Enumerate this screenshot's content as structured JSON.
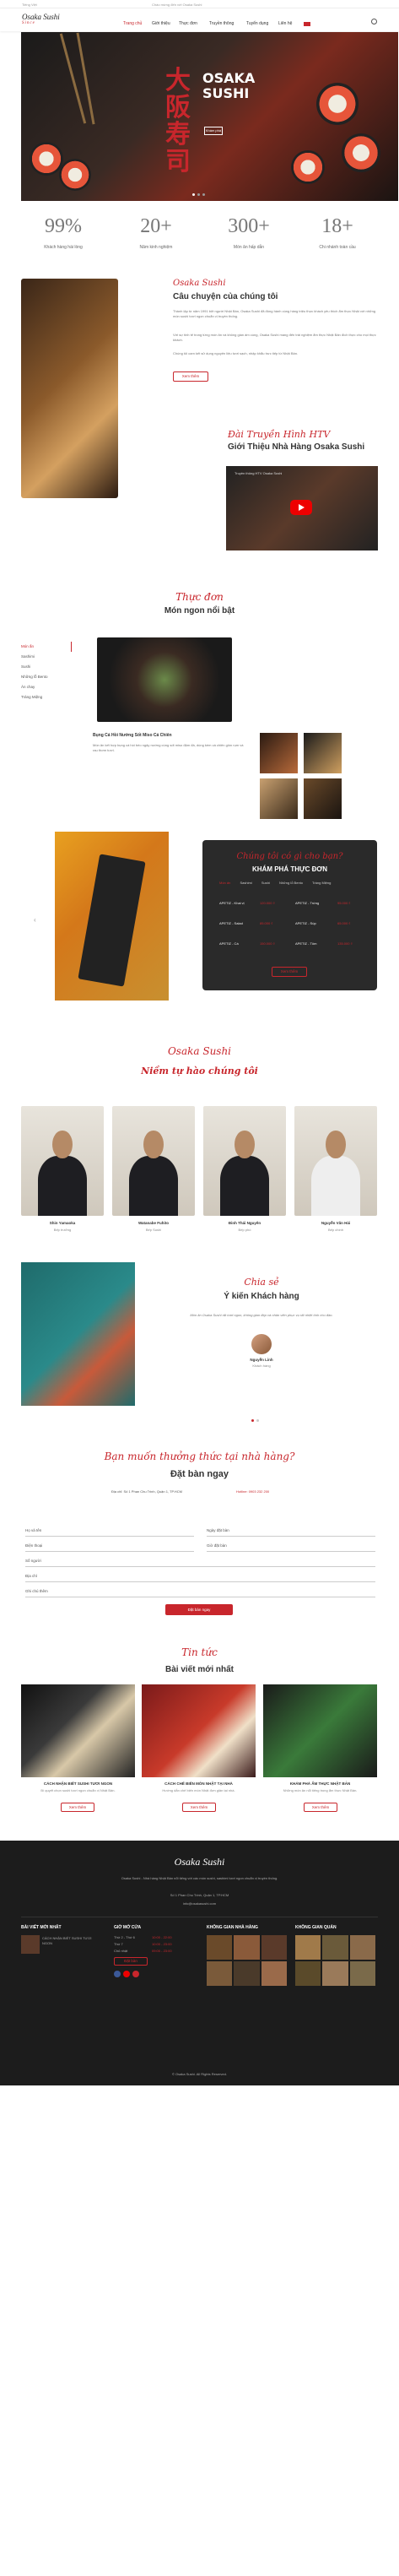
{
  "topbar": {
    "left": "Tiếng Việt",
    "right": "Chào mừng đến với Osaka Sushi"
  },
  "brand": {
    "name": "Osaka Sushi",
    "sub": "Since"
  },
  "nav": [
    "Trang chủ",
    "Giới thiệu",
    "Thực đơn",
    "Truyền thông",
    "Tuyển dụng",
    "Liên hệ"
  ],
  "hero": {
    "title_jp": "大阪寿司",
    "title": "OSAKA SUSHI",
    "button": "Khám phá"
  },
  "stats": [
    {
      "num": "99%",
      "label": "Khách hàng hài lòng"
    },
    {
      "num": "20+",
      "label": "Năm kinh nghiệm"
    },
    {
      "num": "300+",
      "label": "Món ăn hấp dẫn"
    },
    {
      "num": "18+",
      "label": "Chi nhánh toàn cầu"
    }
  ],
  "story": {
    "script": "Osaka Sushi",
    "title": "Câu chuyện của chúng tôi",
    "p1": "Thành lập từ năm 1991 bởi người Nhật Bản, Osaka Sushi đã đồng hành cùng hàng triệu thực khách yêu thích ẩm thực Nhật với những món sushi tươi ngon chuẩn vị truyền thống.",
    "p2": "Với sự tinh tế trong từng món ăn và không gian ấm cúng, Osaka Sushi mang đến trải nghiệm ẩm thực Nhật Bản đích thực cho mọi thực khách.",
    "p3": "Chúng tôi cam kết sử dụng nguyên liệu tươi sạch, nhập khẩu trực tiếp từ Nhật Bản.",
    "button": "Xem thêm"
  },
  "video": {
    "script": "Đài Truyền Hình HTV",
    "title": "Giới Thiệu Nhà Hàng Osaka Sushi",
    "yt_title": "Truyền thông HTV Osaka Sushi"
  },
  "menu": {
    "script": "Thực đơn",
    "title": "Món ngon nổi bật",
    "cats": [
      "Món ấn",
      "Sashimi",
      "Sushi",
      "Những lỗ Bento",
      "Ăn chay",
      "Tráng Miệng"
    ],
    "dish_title": "Bụng Cá Hồi Nướng Sốt Miso Cá Chiên",
    "dish_desc": "Món ăn kết hợp bụng cá hồi béo ngậy nướng cùng sốt miso đậm đà, dùng kèm cá chiên giòn rụm và rau thơm tươi."
  },
  "promo": {
    "script": "Chúng tôi có gì cho bạn?",
    "title": "KHÁM PHÁ THỰC ĐƠN",
    "tabs": [
      "Món ấn",
      "Sashimi",
      "Sushi",
      "Những lỗ Bento",
      "Tráng Miệng"
    ],
    "items": [
      {
        "name": "APETIZ - Khai vị",
        "price": "120.000 ₫"
      },
      {
        "name": "APETIZ - Trứng",
        "price": "95.000 ₫"
      },
      {
        "name": "APETIZ - Salad",
        "price": "85.000 ₫"
      },
      {
        "name": "APETIZ - Súp",
        "price": "65.000 ₫"
      },
      {
        "name": "APETIZ - Cá",
        "price": "150.000 ₫"
      },
      {
        "name": "APETIZ - Tôm",
        "price": "135.000 ₫"
      }
    ],
    "button": "Xem thêm"
  },
  "team": {
    "script": "Osaka Sushi",
    "title": "Niềm tự hào chúng tôi",
    "chefs": [
      {
        "name": "Shin Yamaoka",
        "role": "Bếp trưởng"
      },
      {
        "name": "Watanabe Fuhito",
        "role": "Bếp Sushi"
      },
      {
        "name": "Đinh Thái Nguyên",
        "role": "Bếp phó"
      },
      {
        "name": "Nguyễn Văn Hải",
        "role": "Bếp chính"
      }
    ]
  },
  "review": {
    "script": "Chia sẻ",
    "title": "Ý kiến Khách hàng",
    "quote": "Món ăn Osaka Sushi rất tươi ngon, không gian đẹp và nhân viên phục vụ rất nhiệt tình chu đáo.",
    "name": "Nguyễn Linh",
    "role": "Khách hàng"
  },
  "reserve": {
    "script": "Bạn muốn thưởng thức tại nhà hàng?",
    "title": "Đặt bàn ngay",
    "addr_label": "Địa chỉ:",
    "addr": "Số 1 Phan Chu Trinh, Quận 1, TP.HCM",
    "hotline_label": "Hotline:",
    "hotline": "0903 232 200",
    "fields": [
      "Họ và tên",
      "Điện thoại",
      "Số người",
      "Địa chỉ",
      "Ghi chú thêm"
    ],
    "date_label": "Ngày đặt bàn",
    "time_label": "Giờ đặt bàn",
    "button": "Đặt bàn ngay"
  },
  "news": {
    "script": "Tin tức",
    "title": "Bài viết mới nhất",
    "posts": [
      {
        "title": "CÁCH NHẬN BIẾT SUSHI TƯƠI NGON",
        "desc": "Bí quyết chọn sushi tươi ngon chuẩn vị Nhật Bản."
      },
      {
        "title": "CÁCH CHẾ BIẾN MÓN NHẬT TẠI NHÀ",
        "desc": "Hướng dẫn chế biến món Nhật đơn giản tại nhà."
      },
      {
        "title": "KHÁM PHÁ ẨM THỰC NHẬT BẢN",
        "desc": "Những món ăn nổi tiếng trong ẩm thực Nhật Bản."
      }
    ],
    "button": "Xem thêm"
  },
  "footer": {
    "brand": "Osaka Sushi",
    "about": "Osaka Sushi - Nhà hàng Nhật Bản nổi tiếng với các món sushi, sashimi tươi ngon chuẩn vị truyền thống.",
    "addr": "Số 1 Phan Chu Trinh, Quận 1, TP.HCM",
    "email": "info@osakasushi.com",
    "col1": "BÀI VIẾT MỚI NHẤT",
    "col2": "GIỜ MỞ CỬA",
    "col3": "KHÔNG GIAN NHÀ HÀNG",
    "col4": "KHÔNG GIAN QUÁN",
    "hours": [
      {
        "d": "Thứ 2 - Thứ 6",
        "t": "10:00 - 22:00"
      },
      {
        "d": "Thứ 7",
        "t": "10:00 - 23:00"
      },
      {
        "d": "Chủ nhật",
        "t": "09:00 - 23:00"
      }
    ],
    "footer_btn": "Đặt bàn",
    "copyright": "© Osaka Sushi. All Rights Reserved."
  },
  "colors": {
    "accent": "#c8262c",
    "dark": "#1c1c1c"
  }
}
